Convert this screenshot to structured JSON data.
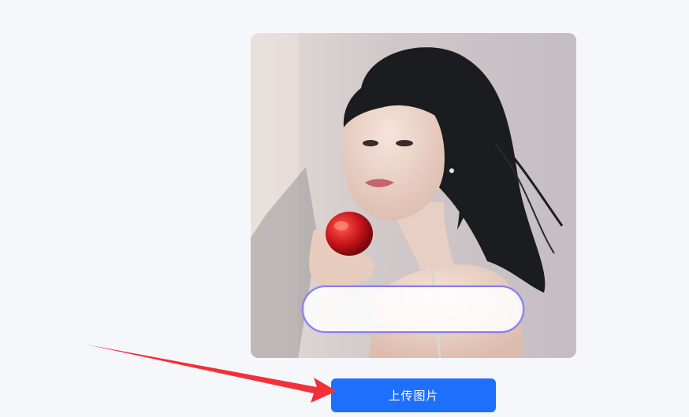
{
  "preview": {
    "image_icon": "portrait-photo",
    "caption_value": ""
  },
  "actions": {
    "upload_label": "上传图片"
  },
  "annotation": {
    "icon": "red-arrow-icon",
    "color": "#f2303a"
  },
  "colors": {
    "page_background": "#f5f7fa",
    "button_primary": "#1e6ffb",
    "pill_border": "#8a7df5"
  }
}
